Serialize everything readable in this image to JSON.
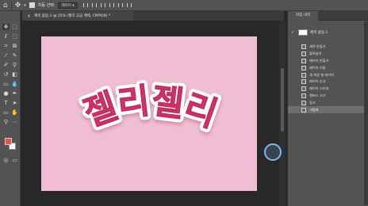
{
  "options_bar": {
    "auto_select_label": "자동 선택:",
    "layer_select_value": "레이어"
  },
  "document_tab": {
    "close_glyph": "×",
    "title": "제목 없음-1 @ 25% (젤리 고급 계체, CMYK/8) *"
  },
  "canvas": {
    "background_color": "#f0bed3",
    "art_text": "젤리젤리",
    "text_fill": "#d6386f",
    "text_outline": "#ffffff"
  },
  "colors": {
    "foreground": "#e3573a",
    "background": "#ffffff"
  },
  "history_panel": {
    "tab_label": "작업 내역",
    "snapshot_name": "제목 없음-1",
    "items": [
      {
        "label": "새로 만들기",
        "active": false
      },
      {
        "label": "붙여넣기",
        "active": false
      },
      {
        "label": "레이어 만들기",
        "active": false
      },
      {
        "label": "레이어 이동",
        "active": false
      },
      {
        "label": "새 색상 칠 레이어",
        "active": false
      },
      {
        "label": "레이어 순서",
        "active": false
      },
      {
        "label": "레이어 스타일",
        "active": false
      },
      {
        "label": "캔버스 크기",
        "active": false
      },
      {
        "label": "링크",
        "active": false
      },
      {
        "label": "그림자",
        "active": true
      }
    ]
  }
}
